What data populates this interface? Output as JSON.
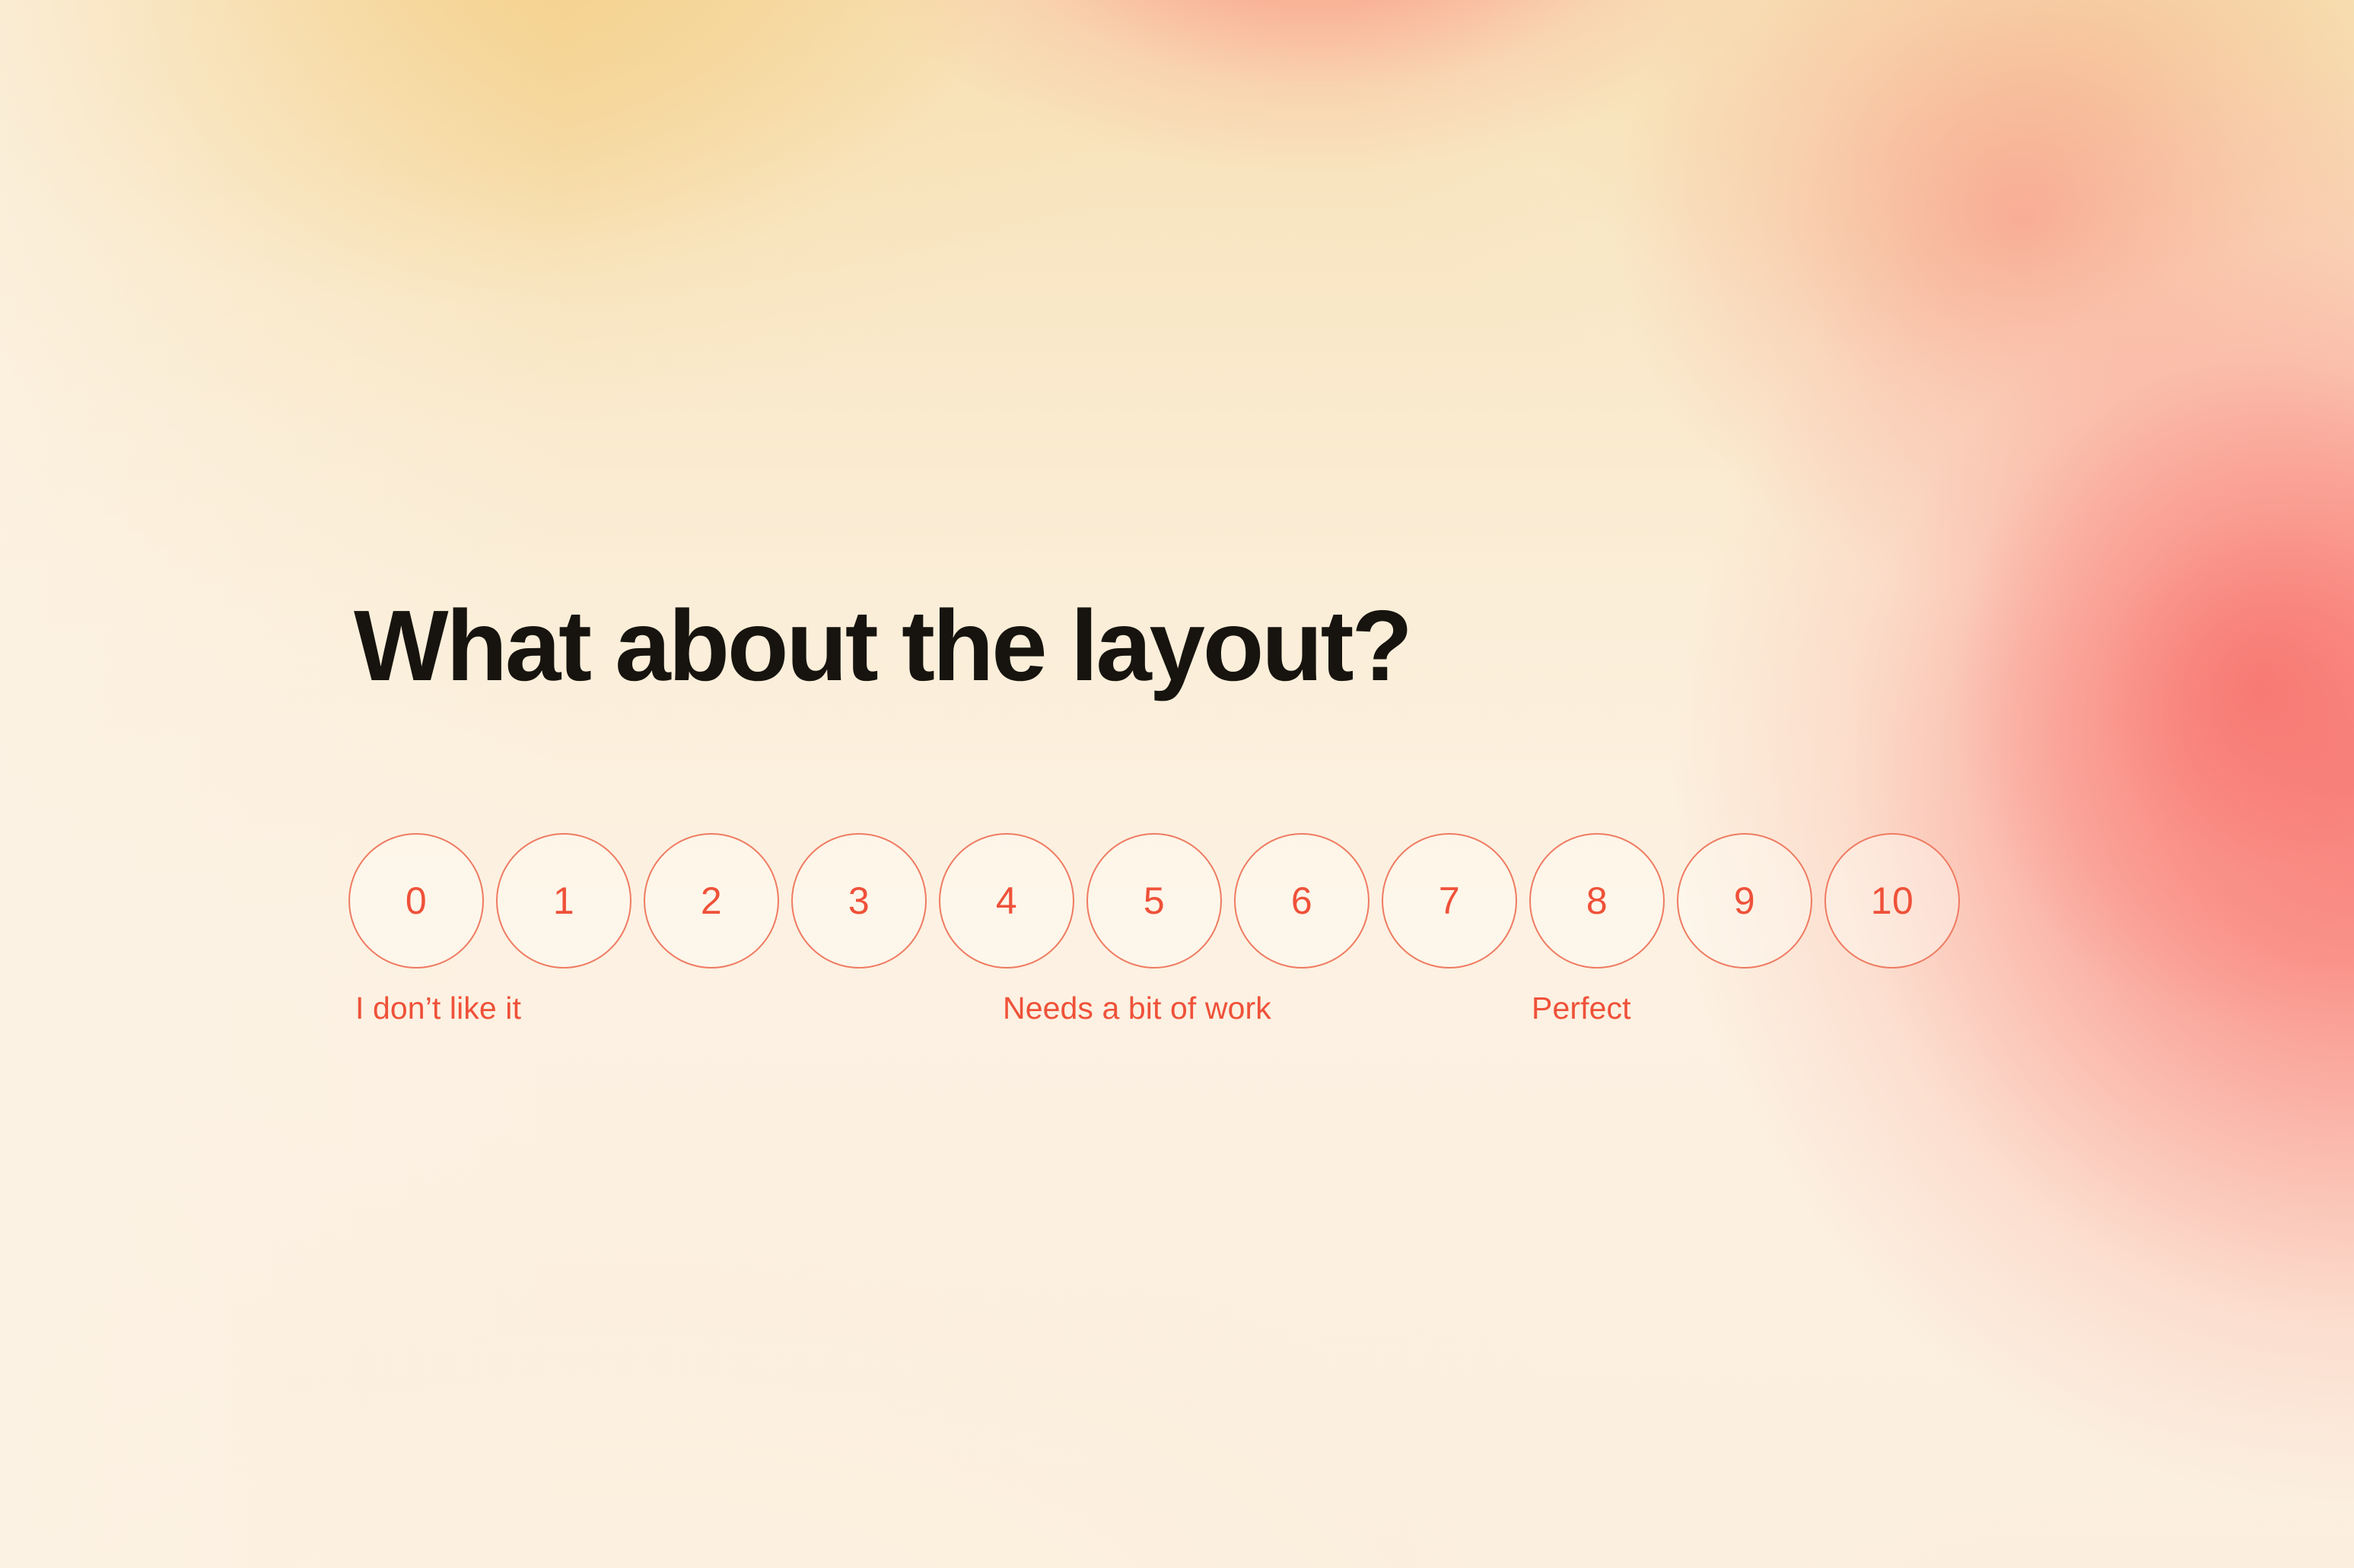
{
  "survey": {
    "question": "What about the layout?",
    "scale": {
      "min": 0,
      "max": 10,
      "options": [
        {
          "value": "0"
        },
        {
          "value": "1"
        },
        {
          "value": "2"
        },
        {
          "value": "3"
        },
        {
          "value": "4"
        },
        {
          "value": "5"
        },
        {
          "value": "6"
        },
        {
          "value": "7"
        },
        {
          "value": "8"
        },
        {
          "value": "9"
        },
        {
          "value": "10"
        }
      ],
      "legend": {
        "low": "I don’t like it",
        "mid": "Needs a bit of work",
        "high": "Perfect"
      }
    }
  },
  "theme": {
    "title_color": "#17140f",
    "accent_color": "#ef5139",
    "circle_border_color": "#ef7b62",
    "circle_fill_color": "rgba(255, 252, 246, 0.42)",
    "background_cream": "#fbefe0",
    "background_gold": "#f4ce84",
    "background_salmon": "#f99681",
    "background_coral": "#f87874"
  }
}
